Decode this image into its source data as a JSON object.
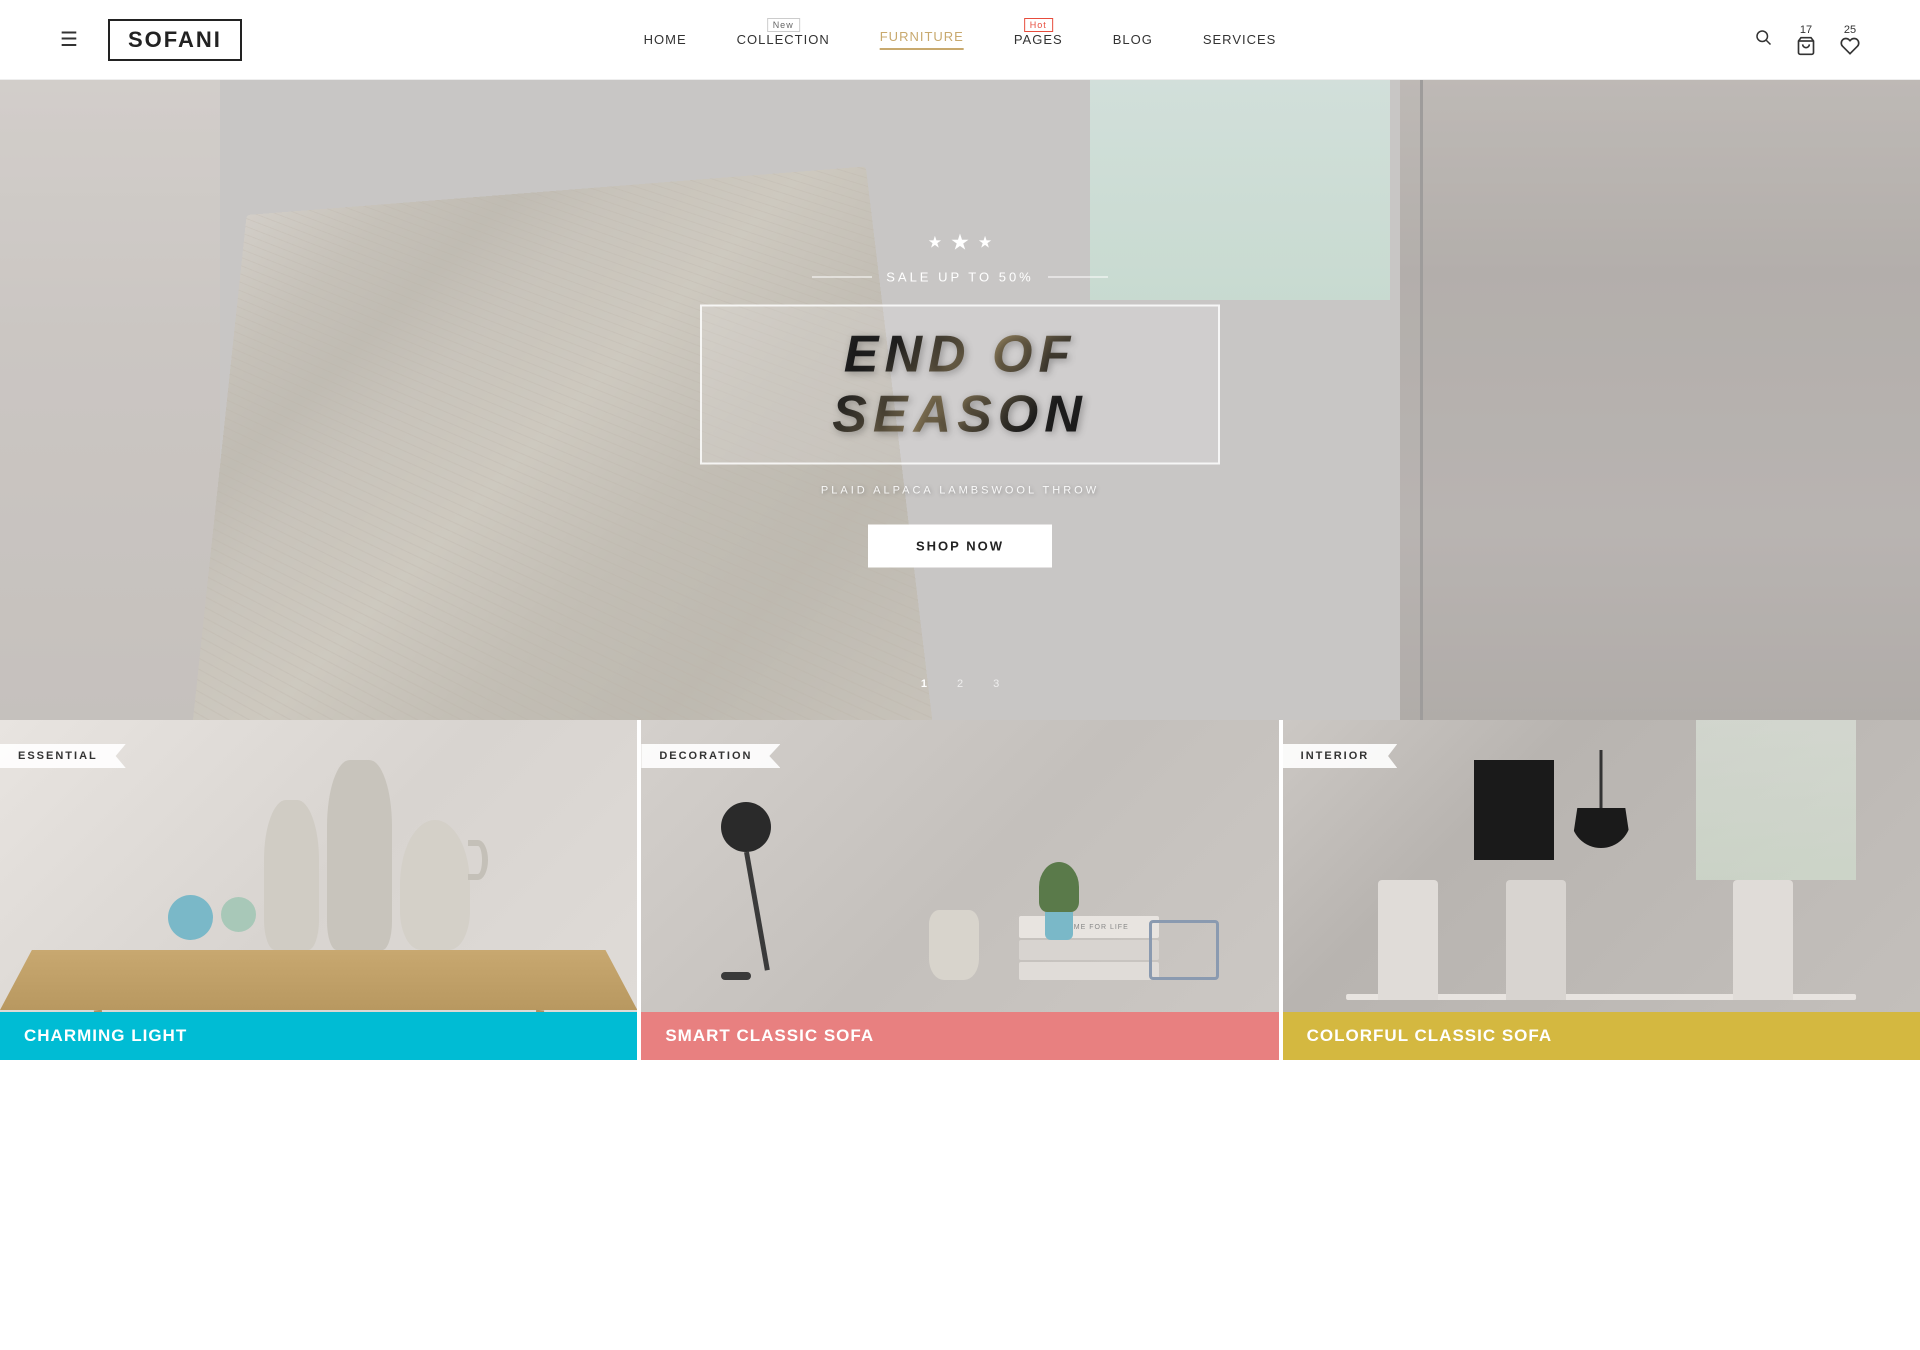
{
  "header": {
    "logo": "SOFANI",
    "hamburger_icon": "☰",
    "nav": [
      {
        "label": "HOME",
        "active": false,
        "badge": null
      },
      {
        "label": "COLLECTION",
        "active": false,
        "badge": "New"
      },
      {
        "label": "FURNITURE",
        "active": true,
        "badge": null
      },
      {
        "label": "PAGES",
        "active": false,
        "badge": "Hot"
      },
      {
        "label": "BLOG",
        "active": false,
        "badge": null
      },
      {
        "label": "SERVICES",
        "active": false,
        "badge": null
      }
    ],
    "cart_count": "17",
    "wishlist_count": "25",
    "search_icon": "🔍",
    "cart_icon": "🛒",
    "heart_icon": "♡"
  },
  "hero": {
    "sale_text": "SALE UP TO 50%",
    "title": "END OF SEASON",
    "subtitle": "PLAID ALPACA LAMBSWOOL THROW",
    "cta_label": "SHOP NOW",
    "dots": [
      "1",
      "2",
      "3"
    ],
    "stars": [
      "★",
      "★",
      "★"
    ]
  },
  "products": [
    {
      "label": "ESSENTIAL",
      "name": "CHARMING LIGHT",
      "bar_class": "bar-cyan"
    },
    {
      "label": "DECORATION",
      "name": "SMART CLASSIC SOFA",
      "bar_class": "bar-salmon"
    },
    {
      "label": "INTERIOR",
      "name": "COLORFUL CLASSIC SOFA",
      "bar_class": "bar-yellow"
    }
  ]
}
